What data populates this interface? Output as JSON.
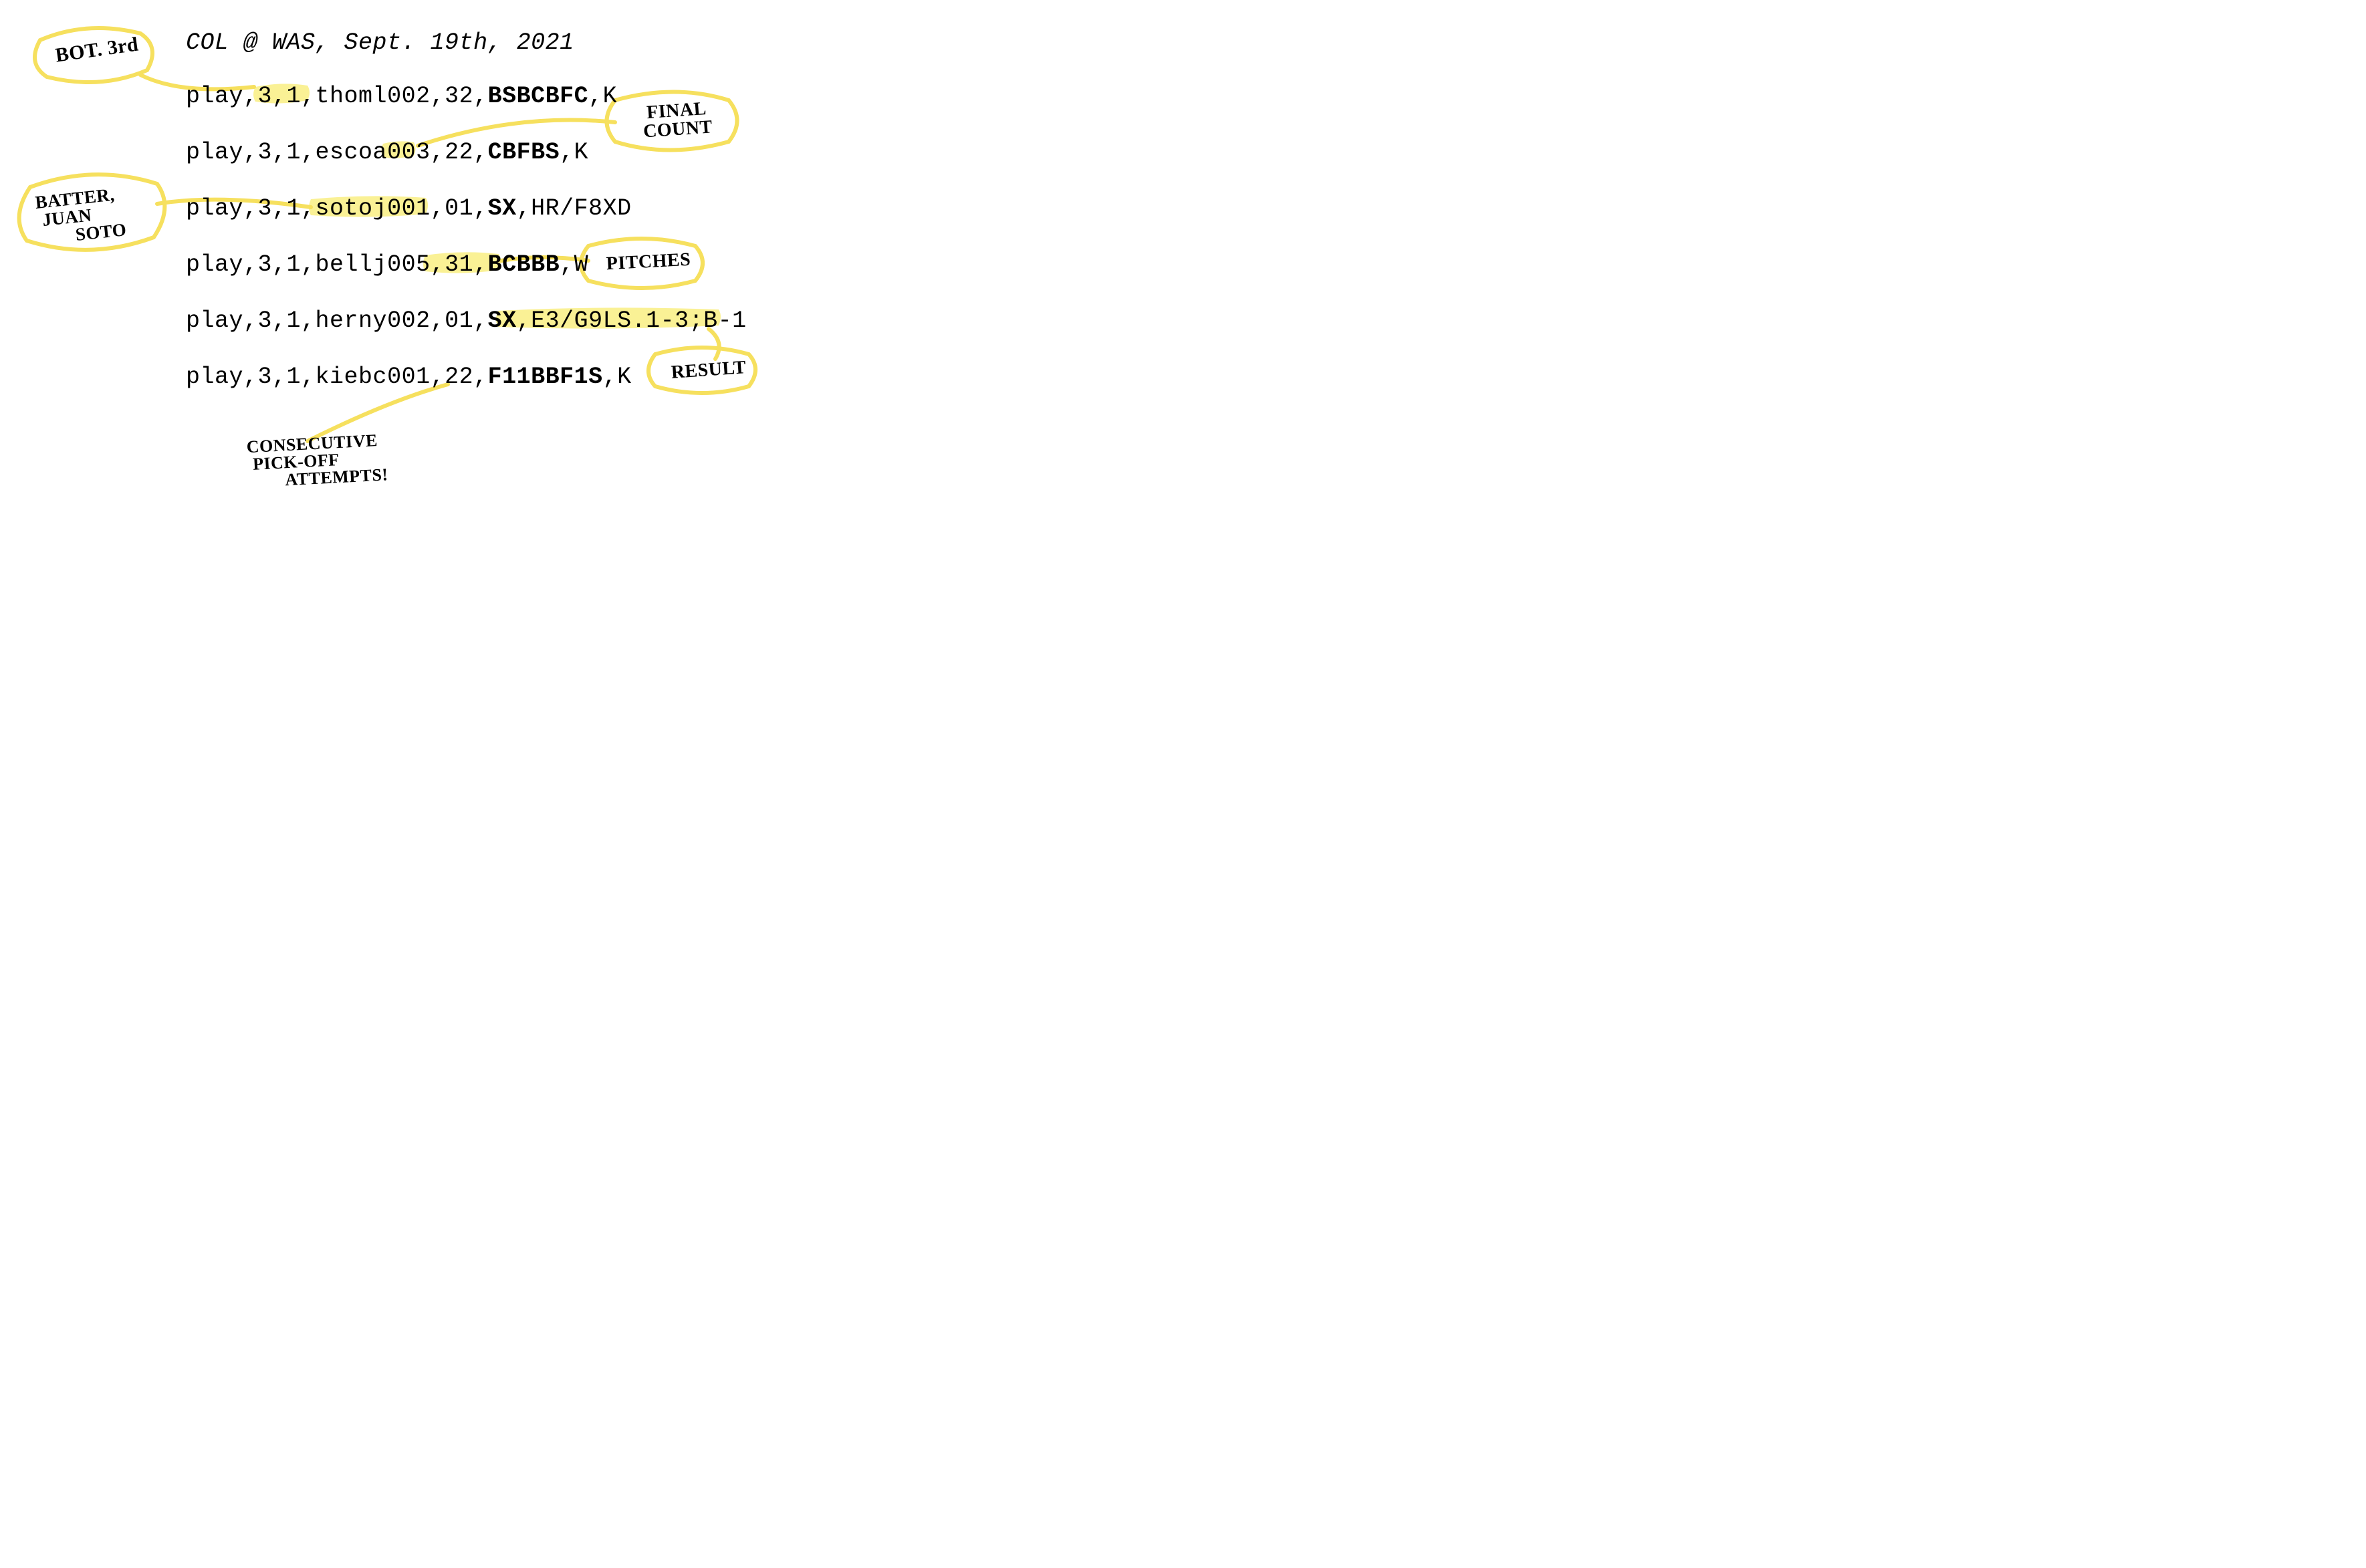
{
  "title": "COL @ WAS, Sept. 19th, 2021",
  "rows": [
    {
      "prefix": "play,",
      "inning_half": "3,1,",
      "batter": "thoml002",
      "count": ",32,",
      "pitches": "BSBCBFC",
      "result": ",K"
    },
    {
      "prefix": "play,",
      "inning_half": "3,1,",
      "batter": "escoa003",
      "count": ",",
      "count_hl": "22",
      "count_suffix": ",",
      "pitches": "CBFBS",
      "result": ",K"
    },
    {
      "prefix": "play,",
      "inning_half": "3,1,",
      "batter": "sotoj001",
      "count": ",01,",
      "pitches": "SX",
      "result": ",HR/F8XD"
    },
    {
      "prefix": "play,",
      "inning_half": "3,1,",
      "batter": "bellj005",
      "count": ",31,",
      "pitches": "BCBBB",
      "result": ",W"
    },
    {
      "prefix": "play,",
      "inning_half": "3,1,",
      "batter": "herny002",
      "count": ",01,",
      "pitches": "SX",
      "result": ",E3/G9LS.1-3;B-1"
    },
    {
      "prefix": "play,",
      "inning_half": "3,1,",
      "batter": "kiebc001",
      "count": ",22,",
      "pitches": "F11BBF1S",
      "result": ",K"
    }
  ],
  "callouts": {
    "bot3rd": "BOT. 3rd",
    "finalcount_l1": "FINAL",
    "finalcount_l2": "COUNT",
    "batter_l1": "BATTER,",
    "batter_l2": "JUAN",
    "batter_l3": "SOTO",
    "pitches": "PITCHES",
    "result": "RESULT",
    "pickoff_l1": "CONSECUTIVE",
    "pickoff_l2": "PICK-OFF",
    "pickoff_l3": "ATTEMPTS!"
  }
}
